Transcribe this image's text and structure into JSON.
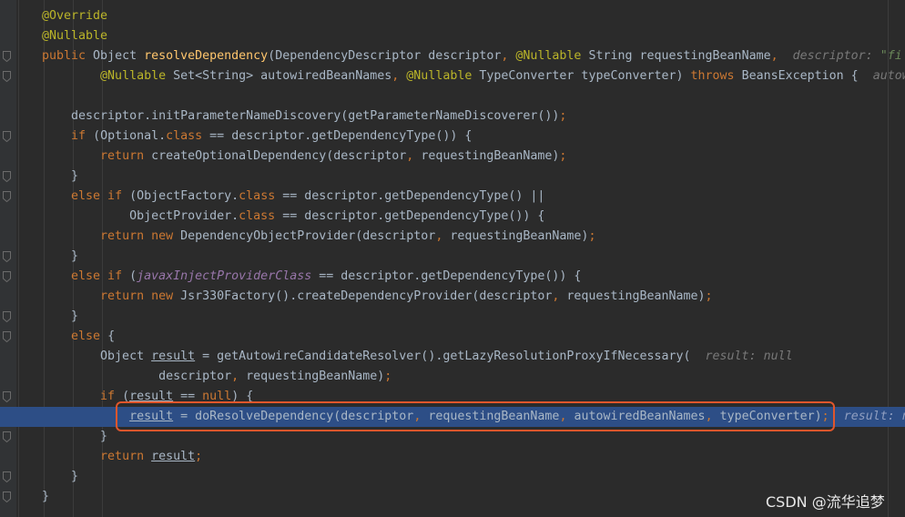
{
  "lines": [
    [
      {
        "t": "@Override",
        "c": "ann"
      }
    ],
    [
      {
        "t": "@Nullable",
        "c": "ann"
      }
    ],
    [
      {
        "t": "public ",
        "c": "kw"
      },
      {
        "t": "Object "
      },
      {
        "t": "resolveDependency",
        "c": "fn"
      },
      {
        "t": "(DependencyDescriptor descriptor"
      },
      {
        "t": ", ",
        "c": "kw"
      },
      {
        "t": "@Nullable ",
        "c": "ann"
      },
      {
        "t": "String requestingBeanName"
      },
      {
        "t": ",  ",
        "c": "kw"
      },
      {
        "t": "descriptor: ",
        "c": "hint"
      },
      {
        "t": "\"fi",
        "c": "vstr"
      }
    ],
    [
      {
        "t": "        "
      },
      {
        "t": "@Nullable ",
        "c": "ann"
      },
      {
        "t": "Set<String> autowiredBeanNames"
      },
      {
        "t": ", ",
        "c": "kw"
      },
      {
        "t": "@Nullable ",
        "c": "ann"
      },
      {
        "t": "TypeConverter typeConverter) "
      },
      {
        "t": "throws ",
        "c": "kw"
      },
      {
        "t": "BeansException {  "
      },
      {
        "t": "autow",
        "c": "hint"
      }
    ],
    [],
    [
      {
        "t": "    descriptor.initParameterNameDiscovery(getParameterNameDiscoverer())"
      },
      {
        "t": ";",
        "c": "kw"
      }
    ],
    [
      {
        "t": "    "
      },
      {
        "t": "if ",
        "c": "kw"
      },
      {
        "t": "(Optional."
      },
      {
        "t": "class ",
        "c": "kw"
      },
      {
        "t": "== descriptor.getDependencyType()) {"
      }
    ],
    [
      {
        "t": "        "
      },
      {
        "t": "return ",
        "c": "kw"
      },
      {
        "t": "createOptionalDependency(descriptor"
      },
      {
        "t": ", ",
        "c": "kw"
      },
      {
        "t": "requestingBeanName)"
      },
      {
        "t": ";",
        "c": "kw"
      }
    ],
    [
      {
        "t": "    }"
      }
    ],
    [
      {
        "t": "    "
      },
      {
        "t": "else if ",
        "c": "kw"
      },
      {
        "t": "(ObjectFactory."
      },
      {
        "t": "class ",
        "c": "kw"
      },
      {
        "t": "== descriptor.getDependencyType() ||"
      }
    ],
    [
      {
        "t": "            ObjectProvider."
      },
      {
        "t": "class ",
        "c": "kw"
      },
      {
        "t": "== descriptor.getDependencyType()) {"
      }
    ],
    [
      {
        "t": "        "
      },
      {
        "t": "return new ",
        "c": "kw"
      },
      {
        "t": "DependencyObjectProvider(descriptor"
      },
      {
        "t": ", ",
        "c": "kw"
      },
      {
        "t": "requestingBeanName)"
      },
      {
        "t": ";",
        "c": "kw"
      }
    ],
    [
      {
        "t": "    }"
      }
    ],
    [
      {
        "t": "    "
      },
      {
        "t": "else if ",
        "c": "kw"
      },
      {
        "t": "("
      },
      {
        "t": "javaxInjectProviderClass",
        "c": "fld it"
      },
      {
        "t": " == descriptor.getDependencyType()) {"
      }
    ],
    [
      {
        "t": "        "
      },
      {
        "t": "return new ",
        "c": "kw"
      },
      {
        "t": "Jsr330Factory().createDependencyProvider(descriptor"
      },
      {
        "t": ", ",
        "c": "kw"
      },
      {
        "t": "requestingBeanName)"
      },
      {
        "t": ";",
        "c": "kw"
      }
    ],
    [
      {
        "t": "    }"
      }
    ],
    [
      {
        "t": "    "
      },
      {
        "t": "else ",
        "c": "kw"
      },
      {
        "t": "{"
      }
    ],
    [
      {
        "t": "        Object "
      },
      {
        "t": "result",
        "c": "ul"
      },
      {
        "t": " = getAutowireCandidateResolver().getLazyResolutionProxyIfNecessary(  "
      },
      {
        "t": "result: null",
        "c": "hint"
      }
    ],
    [
      {
        "t": "                descriptor"
      },
      {
        "t": ", ",
        "c": "kw"
      },
      {
        "t": "requestingBeanName)"
      },
      {
        "t": ";",
        "c": "kw"
      }
    ],
    [
      {
        "t": "        "
      },
      {
        "t": "if ",
        "c": "kw"
      },
      {
        "t": "("
      },
      {
        "t": "result",
        "c": "ul"
      },
      {
        "t": " == "
      },
      {
        "t": "null",
        "c": "kw"
      },
      {
        "t": ") {"
      }
    ],
    [
      {
        "t": "            "
      },
      {
        "t": "result",
        "c": "ul"
      },
      {
        "t": " = doResolveDependency(descriptor"
      },
      {
        "t": ", ",
        "c": "kw"
      },
      {
        "t": "requestingBeanName"
      },
      {
        "t": ", ",
        "c": "kw"
      },
      {
        "t": "autowiredBeanNames"
      },
      {
        "t": ", ",
        "c": "kw"
      },
      {
        "t": "typeConverter)"
      },
      {
        "t": ";",
        "c": "kw"
      },
      {
        "t": "  "
      },
      {
        "t": "result: n",
        "c": "hint"
      }
    ],
    [
      {
        "t": "        }"
      }
    ],
    [
      {
        "t": "        "
      },
      {
        "t": "return ",
        "c": "kw"
      },
      {
        "t": "result",
        "c": "ul"
      },
      {
        "t": ";",
        "c": "kw"
      }
    ],
    [
      {
        "t": "    }"
      }
    ],
    [
      {
        "t": "}"
      }
    ]
  ],
  "highlighted_line": 20,
  "fold_markers": [
    2,
    3,
    6,
    8,
    9,
    12,
    13,
    15,
    16,
    19,
    21,
    23,
    24
  ],
  "watermark": "CSDN @流华追梦",
  "colors": {
    "background": "#2b2b2b",
    "gutter": "#313335",
    "text": "#a9b7c6",
    "keyword": "#cc7832",
    "annotation": "#bbb529",
    "method_declaration": "#ffc66d",
    "static_field": "#9876aa",
    "inline_hint": "#787878",
    "execution_line": "#2d4e86",
    "callout_border": "#e0562c"
  }
}
